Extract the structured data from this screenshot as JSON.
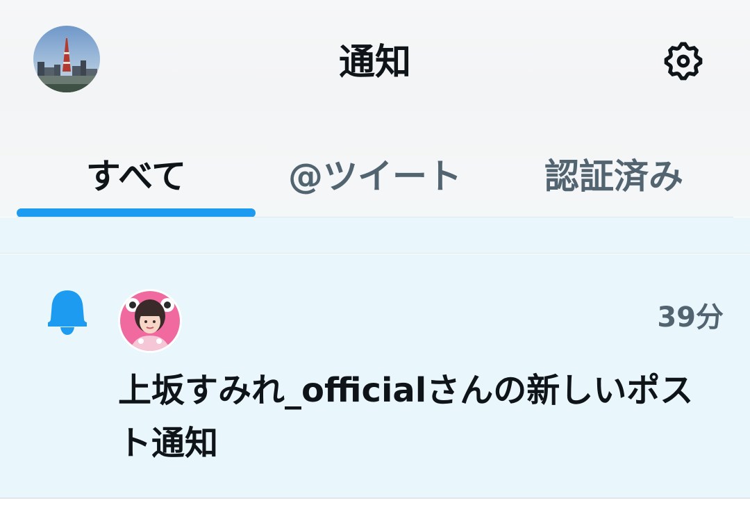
{
  "header": {
    "title": "通知",
    "user_avatar_icon": "user-avatar-tokyo-tower",
    "settings_icon": "gear-icon"
  },
  "tabs": [
    {
      "label": "すべて",
      "active": true
    },
    {
      "label": "@ツイート",
      "active": false
    },
    {
      "label": "認証済み",
      "active": false
    }
  ],
  "notifications": [
    {
      "icon": "bell-icon",
      "avatar": "account-avatar",
      "time": "39分",
      "text": "上坂すみれ_officialさんの新しいポスト通知"
    }
  ],
  "colors": {
    "accent": "#1d9bf0",
    "text_primary": "#0f1419",
    "text_secondary": "#536471",
    "unread_background": "#e9f6fc"
  }
}
